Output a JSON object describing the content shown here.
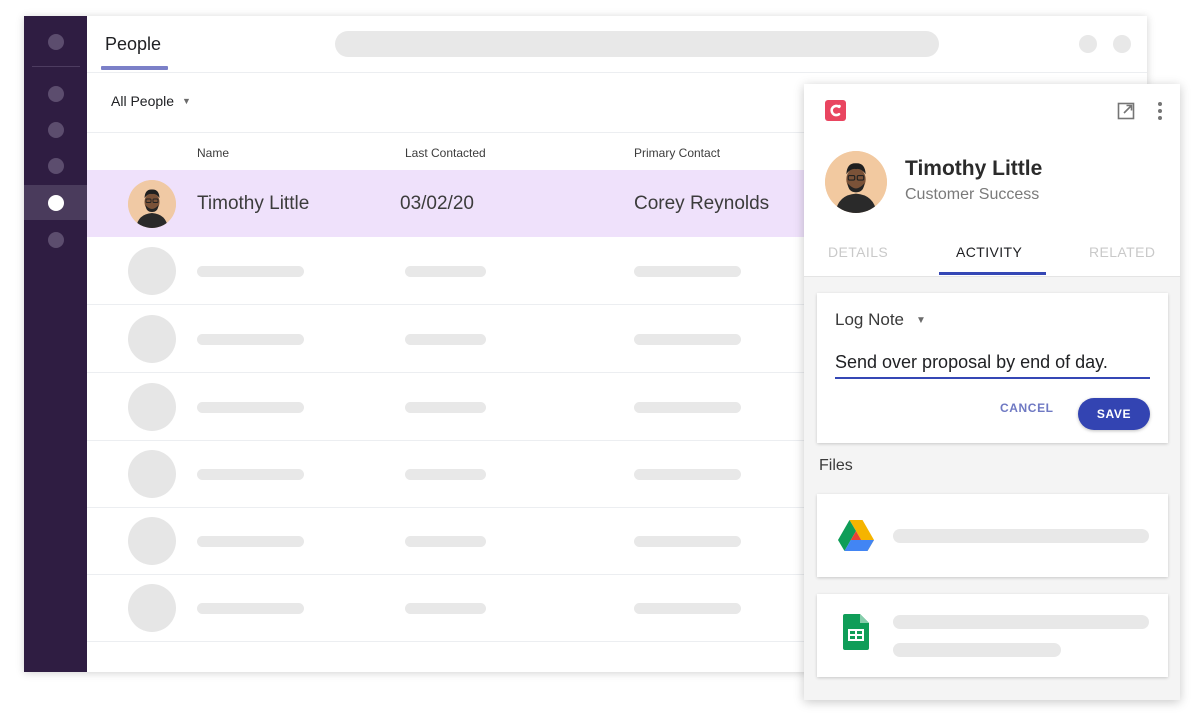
{
  "header": {
    "title": "People"
  },
  "filter": {
    "label": "All People"
  },
  "table": {
    "columns": [
      "Name",
      "Last Contacted",
      "Primary Contact"
    ],
    "rows": [
      {
        "name": "Timothy Little",
        "last_contacted": "03/02/20",
        "primary_contact": "Corey Reynolds",
        "selected": true
      }
    ],
    "placeholder_rows": 6
  },
  "panel": {
    "contact": {
      "name": "Timothy Little",
      "role": "Customer Success"
    },
    "tabs": [
      {
        "label": "DETAILS",
        "active": false
      },
      {
        "label": "ACTIVITY",
        "active": true
      },
      {
        "label": "RELATED",
        "active": false
      }
    ],
    "note": {
      "type": "Log Note",
      "value": "Send over proposal by end of day.",
      "cancel_label": "CANCEL",
      "save_label": "SAVE"
    },
    "files": {
      "label": "Files",
      "items": [
        {
          "icon": "google-drive-icon"
        },
        {
          "icon": "google-sheets-icon"
        }
      ]
    }
  },
  "colors": {
    "sidebar": "#2f1d42",
    "selected_row": "#efe1fb",
    "accent": "#3547b5",
    "brand": "#e94560"
  }
}
